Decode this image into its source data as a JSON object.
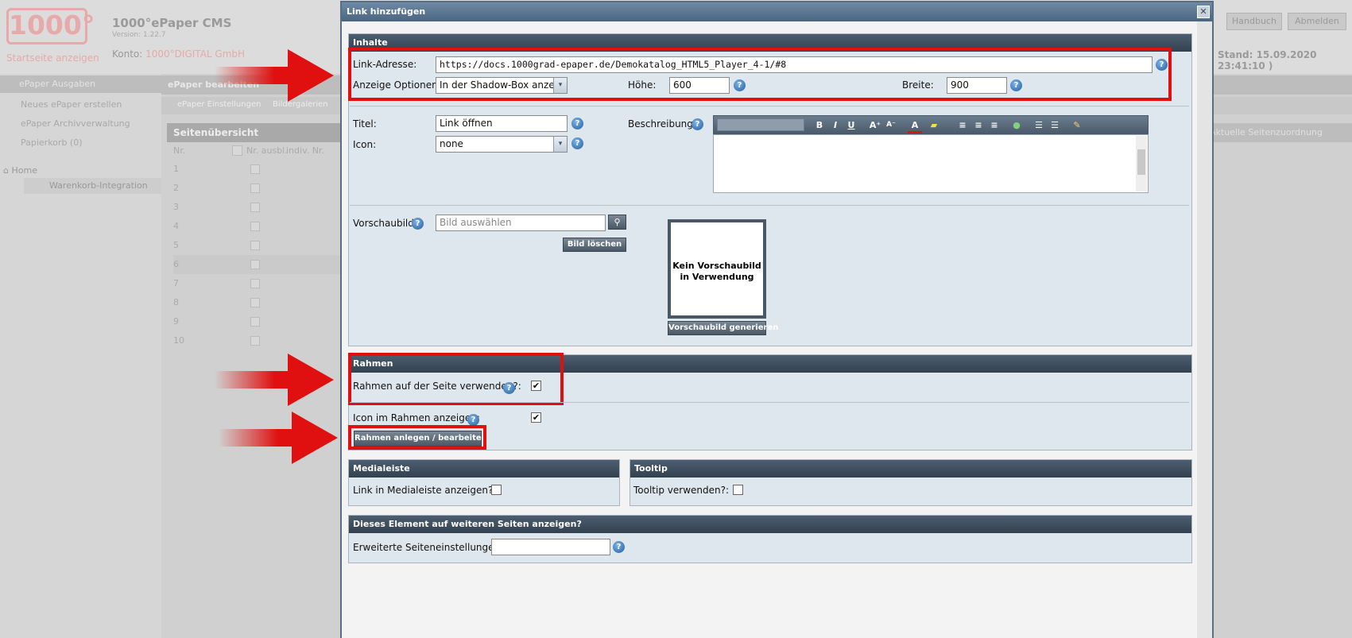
{
  "app": {
    "logo_text": "1000°",
    "logo_tagline": "Startseite anzeigen",
    "title": "1000°ePaper CMS",
    "version": "Version: 1.22.7",
    "konto_label": "Konto:",
    "konto_value": "1000°DIGITAL GmbH",
    "handbuch_label": "Handbuch",
    "abmelden_label": "Abmelden",
    "stand": "Stand: 15.09.2020 23:41:10 )"
  },
  "sidebar": {
    "header": "ePaper Ausgaben",
    "items": [
      {
        "label": "Neues ePaper erstellen"
      },
      {
        "label": "ePaper Archivverwaltung"
      },
      {
        "label": "Papierkorb (0)"
      }
    ],
    "tree_root": "Home",
    "tree_child": "Warenkorb-Integration"
  },
  "main": {
    "tab_label": "ePaper bearbeiten",
    "toolbar_items": [
      "ePaper Einstellungen",
      "Bildergalerien"
    ],
    "seiten_header": "Seitenübersicht",
    "col_nr": "Nr.",
    "col_nr_ausbl": "Nr. ausbl.",
    "col_indiv": "indiv. Nr.",
    "rows": [
      "1",
      "2",
      "3",
      "4",
      "5",
      "6",
      "7",
      "8",
      "9",
      "10"
    ],
    "right_bar": "Aktuelle Seitenzuordnung"
  },
  "dialog": {
    "title": "Link hinzufügen",
    "close_glyph": "✕",
    "inhalte": {
      "header": "Inhalte",
      "link_label": "Link-Adresse:",
      "link_value": "https://docs.1000grad-epaper.de/Demokatalog_HTML5_Player_4-1/#8",
      "anzeige_label": "Anzeige Optionen:",
      "anzeige_value": "In der Shadow-Box anzeig",
      "hoehe_label": "Höhe:",
      "hoehe_value": "600",
      "breite_label": "Breite:",
      "breite_value": "900",
      "titel_label": "Titel:",
      "titel_value": "Link öffnen",
      "icon_label": "Icon:",
      "icon_value": "none",
      "beschreibung_label": "Beschreibung:",
      "vorschaubild_label": "Vorschaubild:",
      "vorschaubild_placeholder": "Bild auswählen",
      "bild_loeschen": "Bild löschen",
      "kein_vorschaubild": "Kein Vorschaubild in Verwendung",
      "vorschaubild_generieren": "Vorschaubild generieren"
    },
    "rahmen": {
      "header": "Rahmen",
      "verwenden_label": "Rahmen auf der Seite verwenden?:",
      "verwenden_checked": true,
      "icon_label": "Icon im Rahmen anzeigen:",
      "icon_checked": true,
      "button_label": "Rahmen anlegen / bearbeiten"
    },
    "medialeiste": {
      "header": "Medialeiste",
      "label": "Link in Medialeiste anzeigen?:"
    },
    "tooltip": {
      "header": "Tooltip",
      "label": "Tooltip verwenden?:"
    },
    "weitere": {
      "header": "Dieses Element auf weiteren Seiten anzeigen?",
      "label": "Erweiterte Seiteneinstellungen:"
    },
    "check_glyph": "✔",
    "help_glyph": "?",
    "select_arrow_glyph": "▾"
  },
  "colors": {
    "highlight": "#e01010",
    "dialog_header": "#4b6580",
    "panel_header": "#3a4856"
  }
}
